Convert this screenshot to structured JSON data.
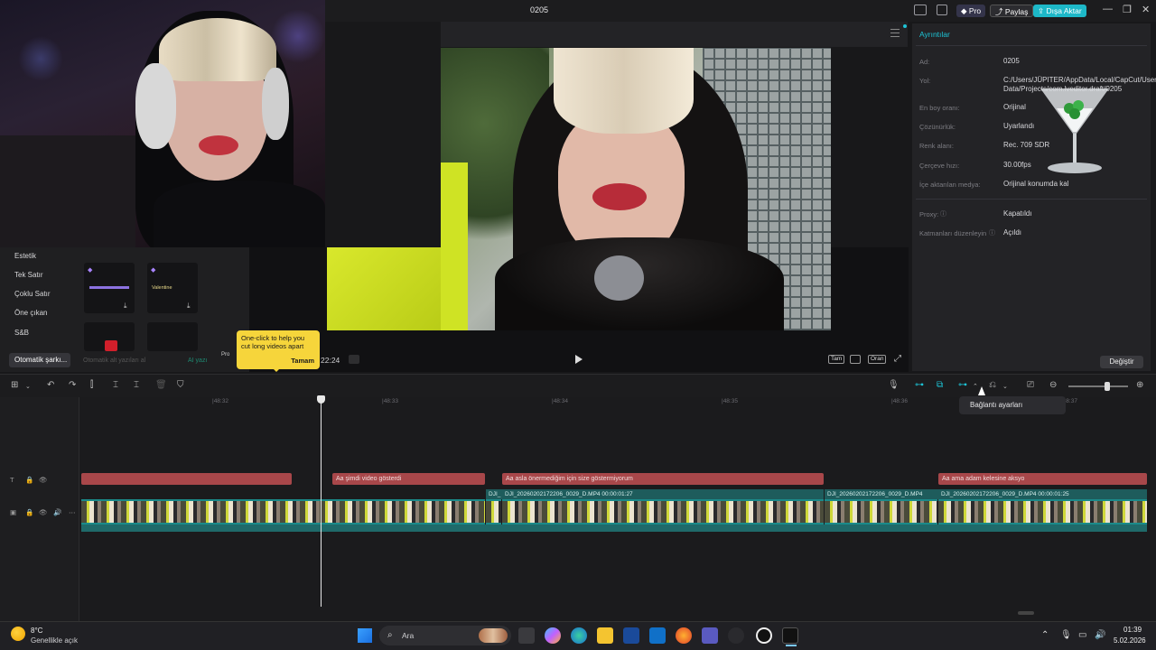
{
  "window": {
    "project_title": "0205",
    "pro_label": "Pro",
    "share_label": "Paylaş",
    "export_label": "Dışa Aktar",
    "minimize": "—",
    "maximize": "❐",
    "close": "✕"
  },
  "left_panel": {
    "categories": [
      "Estetik",
      "Tek Satır",
      "Çoklu Satır",
      "Öne çıkan",
      "S&B"
    ],
    "active_category": "Otomatik şarkı...",
    "tiles": [
      {
        "text": "",
        "pro": true
      },
      {
        "text": "Valentine",
        "pro": true
      }
    ],
    "footer_hint": "Otomatik alt yazıları al",
    "ai_label": "AI yazı",
    "pro_badge": "Pro"
  },
  "tooltip": {
    "text": "One-click to help you cut long videos apart",
    "ok_label": "Tamam"
  },
  "player": {
    "time": "22:24",
    "buttons": [
      "Tam",
      "Oran"
    ]
  },
  "details": {
    "title": "Ayrıntılar",
    "rows": [
      {
        "label": "Ad:",
        "value": "0205"
      },
      {
        "label": "Yol:",
        "value": "C:/Users/JÜPITER/AppData/Local/CapCut/User Data/Projects/com.lveditor.draft/0205"
      },
      {
        "label": "En boy oranı:",
        "value": "Orijinal"
      },
      {
        "label": "Çözünürlük:",
        "value": "Uyarlandı"
      },
      {
        "label": "Renk alanı:",
        "value": "Rec. 709 SDR"
      },
      {
        "label": "Çerçeve hızı:",
        "value": "30.00fps"
      },
      {
        "label": "İçe aktarılan medya:",
        "value": "Orijinal konumda kal"
      },
      {
        "label": "Proxy:",
        "value": "Kapatıldı"
      },
      {
        "label": "Katmanları düzenleyin",
        "value": "Açıldı"
      }
    ],
    "change_button": "Değiştir"
  },
  "timeline": {
    "ruler": [
      "|48:32",
      "|48:33",
      "|48:34",
      "|48:35",
      "|48:36",
      "|48:37"
    ],
    "text_clips": [
      {
        "text": ""
      },
      {
        "text": "Aa şimdi video gösterdi"
      },
      {
        "text": "Aa asla önermediğim için size göstermiyorum"
      },
      {
        "text": "Aa ama adam kelesine aksyo"
      }
    ],
    "video_labels": [
      {
        "text": "DJI_"
      },
      {
        "text": "DJI_20260202172206_0029_D.MP4   00:00:01:27"
      },
      {
        "text": "DJI_20260202172206_0029_D.MP4"
      },
      {
        "text": "DJI_20260202172206_0029_D.MP4   00:00:01:25"
      }
    ],
    "dropdown": "Bağlantı ayarları"
  },
  "taskbar": {
    "temp": "8°C",
    "weather": "Genellikle açık",
    "search_placeholder": "Ara",
    "time": "01:39",
    "date": "5.02.2026"
  }
}
